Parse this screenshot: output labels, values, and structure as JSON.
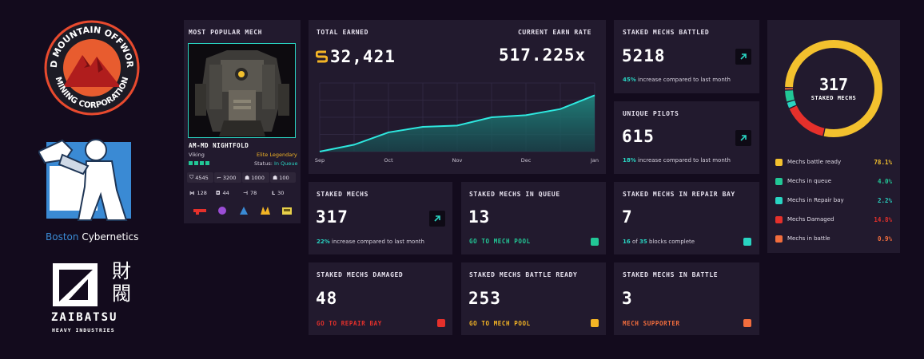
{
  "sidebar": {
    "red_mountain": {
      "logo_text": "RED MOUNTAIN OFFWORLD MINING CORPORATION"
    },
    "boston": {
      "label_a": "Boston",
      "label_b": "Cybernetics"
    },
    "zaibatsu": {
      "kanji_1": "財",
      "kanji_2": "閥",
      "title": "ZAIBATSU",
      "subtitle": "HEAVY INDUSTRIES"
    }
  },
  "popular_mech": {
    "heading": "MOST POPULAR MECH",
    "name": "AM-MD NIGHTFOLD",
    "type": "Viking",
    "rarity": "Elite Legendary",
    "status_label": "Status:",
    "status_value": "In Queue",
    "stats": [
      "4545",
      "3200",
      "1000",
      "100"
    ],
    "stats2": [
      "128",
      "44",
      "78",
      "30"
    ],
    "colors": {
      "rarity": "#f3b425",
      "status": "#29d4c2",
      "pips": "#22c796"
    }
  },
  "earnings": {
    "total_label": "TOTAL EARNED",
    "total_value": "32,421",
    "rate_label": "CURRENT EARN RATE",
    "rate_value": "517.225x",
    "coin_color": "#f3b425"
  },
  "chart_data": {
    "type": "area",
    "x": [
      "Sep",
      "",
      "Oct",
      "",
      "Nov",
      "",
      "Dec",
      "",
      "Jan"
    ],
    "values": [
      0,
      0.1,
      0.28,
      0.36,
      0.38,
      0.5,
      0.53,
      0.62,
      0.82
    ],
    "tick_labels": [
      "Sep",
      "Oct",
      "Nov",
      "Dec",
      "Jan"
    ],
    "tick_x": [
      0,
      2,
      4,
      6,
      8
    ],
    "ylim": [
      0,
      1
    ],
    "grid": true,
    "line_color": "#2ee8df"
  },
  "cards": {
    "battled": {
      "label": "STAKED MECHS BATTLED",
      "value": "5218",
      "pct": "45%",
      "text": "increase compared to last month"
    },
    "pilots": {
      "label": "UNIQUE PILOTS",
      "value": "615",
      "pct": "18%",
      "text": "increase compared to last month"
    },
    "staked": {
      "label": "STAKED MECHS",
      "value": "317",
      "pct": "22%",
      "text": "increase compared to last month"
    },
    "queue": {
      "label": "STAKED MECHS IN QUEUE",
      "value": "13",
      "link": "GO TO MECH POOL",
      "color": "#22c796"
    },
    "repair": {
      "label": "STAKED MECHS IN REPAIR BAY",
      "value": "7",
      "n1": "16",
      "of": "of",
      "n2": "35",
      "text": "blocks complete",
      "color": "#29d4c2"
    },
    "damaged": {
      "label": "STAKED MECHS DAMAGED",
      "value": "48",
      "link": "GO TO REPAIR BAY",
      "color": "#e5302b"
    },
    "battle_ready": {
      "label": "STAKED MECHS BATTLE READY",
      "value": "253",
      "link": "GO TO MECH POOL",
      "color": "#f3b425"
    },
    "in_battle": {
      "label": "STAKED MECHS IN BATTLE",
      "value": "3",
      "link": "MECH SUPPORTER",
      "color": "#f26d3d"
    }
  },
  "donut": {
    "total": "317",
    "label": "STAKED MECHS",
    "legend": [
      {
        "name": "Mechs battle ready",
        "pct": "78.1%",
        "value": 78.1,
        "color": "#f3c12e"
      },
      {
        "name": "Mechs in queue",
        "pct": "4.0%",
        "value": 4.0,
        "color": "#22c796"
      },
      {
        "name": "Mechs in Repair bay",
        "pct": "2.2%",
        "value": 2.2,
        "color": "#29d4c2"
      },
      {
        "name": "Mechs Damaged",
        "pct": "14.8%",
        "value": 14.8,
        "color": "#e5302b"
      },
      {
        "name": "Mechs in battle",
        "pct": "0.9%",
        "value": 0.9,
        "color": "#f26d3d"
      }
    ]
  }
}
